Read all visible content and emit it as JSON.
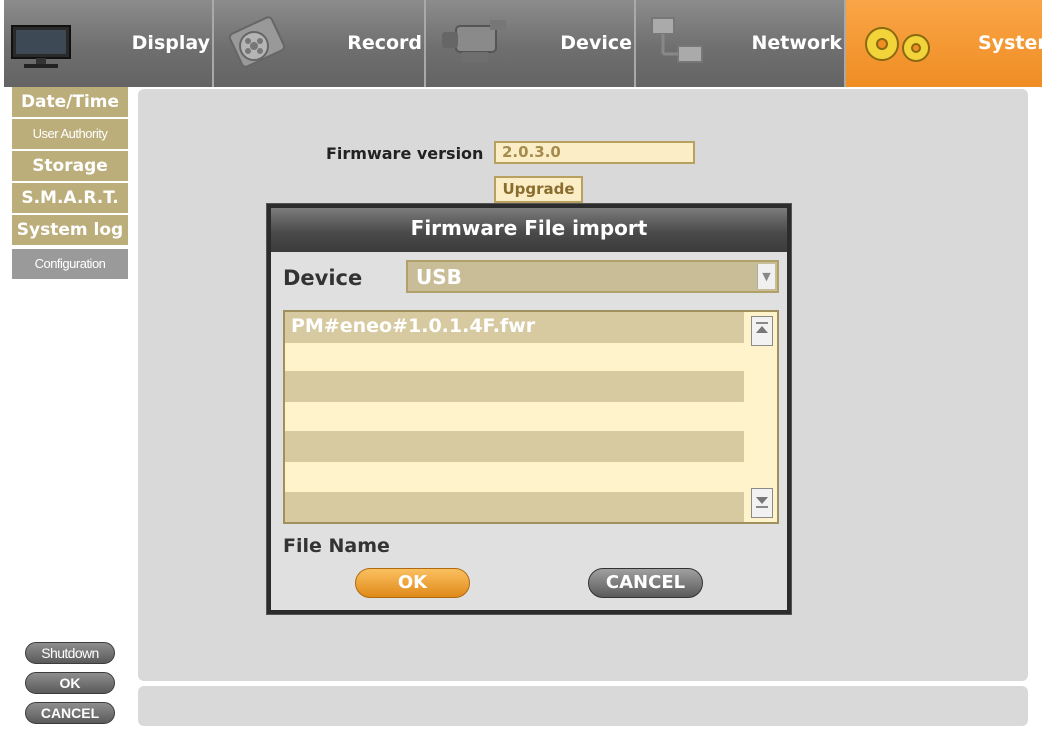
{
  "tabs": [
    {
      "label": "Display",
      "icon": "monitor-icon",
      "active": false
    },
    {
      "label": "Record",
      "icon": "film-reel-icon",
      "active": false
    },
    {
      "label": "Device",
      "icon": "camcorder-icon",
      "active": false
    },
    {
      "label": "Network",
      "icon": "network-icon",
      "active": false
    },
    {
      "label": "System",
      "icon": "gears-icon",
      "active": true
    }
  ],
  "sidebar": {
    "items": [
      {
        "label": "Date/Time"
      },
      {
        "label": "User Authority"
      },
      {
        "label": "Storage"
      },
      {
        "label": "S.M.A.R.T."
      },
      {
        "label": "System log"
      },
      {
        "label": "Configuration",
        "active": true
      }
    ],
    "shutdown_label": "Shutdown",
    "ok_label": "OK",
    "cancel_label": "CANCEL"
  },
  "firmware": {
    "label": "Firmware version",
    "value": "2.0.3.0",
    "upgrade_label": "Upgrade"
  },
  "dialog": {
    "title": "Firmware File import",
    "device_label": "Device",
    "device_value": "USB",
    "files": [
      "PM#eneo#1.0.1.4F.fwr",
      "",
      "",
      "",
      "",
      "",
      ""
    ],
    "file_name_label": "File Name",
    "ok_label": "OK",
    "cancel_label": "CANCEL"
  },
  "colors": {
    "active_tab": "#f08d23",
    "sidebar_item": "#bcae7b",
    "panel": "#d9d9d9",
    "field": "#fbeec7"
  }
}
